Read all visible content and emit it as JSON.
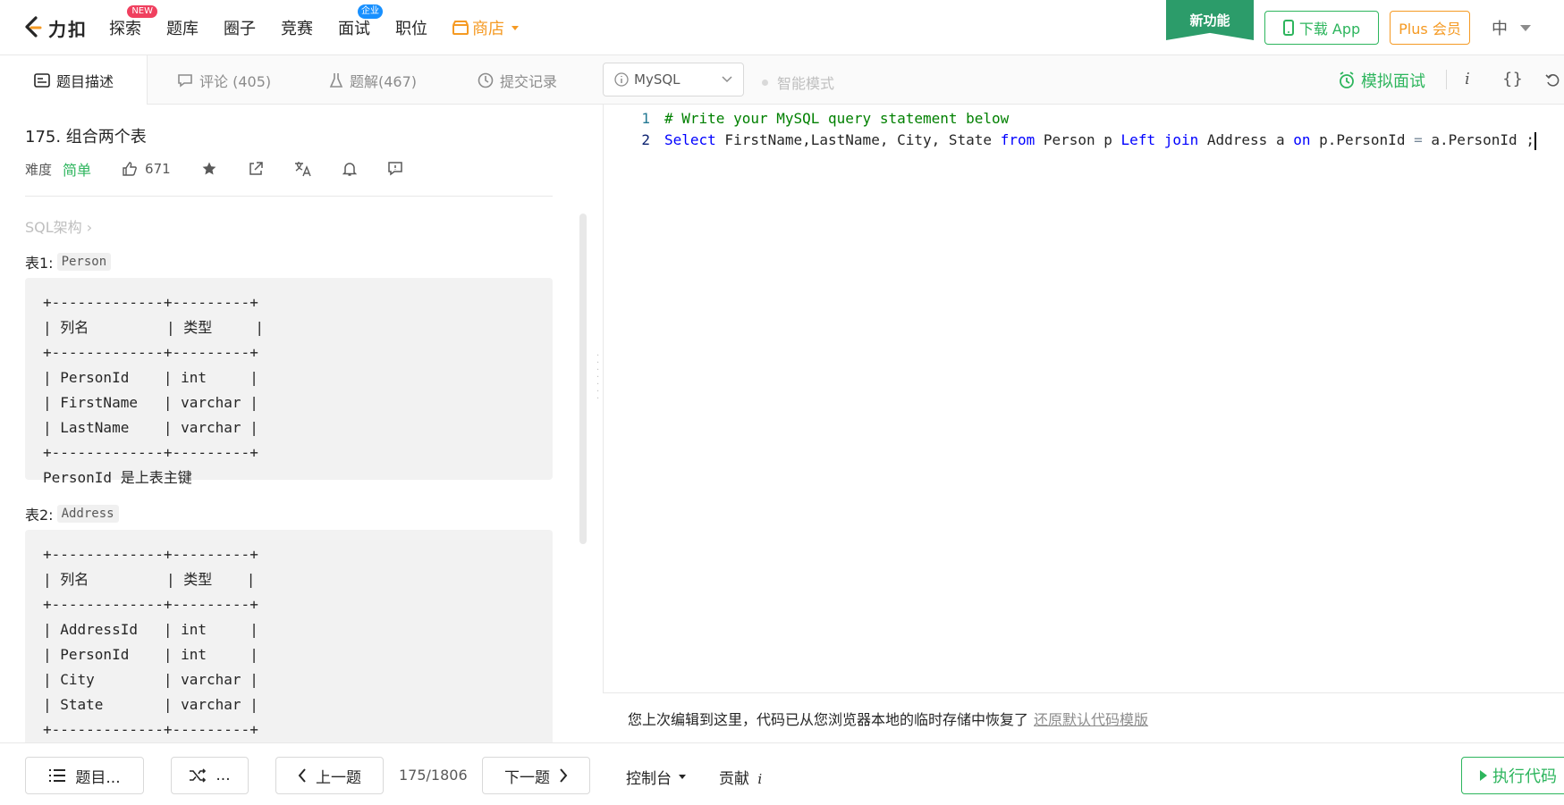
{
  "nav": {
    "logo_text": "力扣",
    "items": [
      {
        "label": "探索",
        "badge": "NEW"
      },
      {
        "label": "题库"
      },
      {
        "label": "圈子"
      },
      {
        "label": "竞赛"
      },
      {
        "label": "面试",
        "badge": "企业"
      },
      {
        "label": "职位"
      }
    ],
    "store_label": "商店",
    "new_feature": "新功能",
    "download_label": "下载 App",
    "plus_label": "Plus 会员",
    "lang_label": "中"
  },
  "tabs": {
    "description": "题目描述",
    "comments": "评论 (405)",
    "solutions": "题解(467)",
    "submissions": "提交记录",
    "language": "MySQL",
    "smart_mode": "智能模式",
    "mock_interview": "模拟面试",
    "info_icon": "i",
    "braces_icon": "{}"
  },
  "problem": {
    "title": "175. 组合两个表",
    "difficulty_label": "难度",
    "difficulty": "简单",
    "likes": "671",
    "schema_link": "SQL架构 ›",
    "table1_label": "表1:",
    "table1_name": "Person",
    "table1_body": "+-------------+---------+\n| 列名         | 类型     |\n+-------------+---------+\n| PersonId    | int     |\n| FirstName   | varchar |\n| LastName    | varchar |\n+-------------+---------+\nPersonId 是上表主键",
    "table2_label": "表2:",
    "table2_name": "Address",
    "table2_body": "+-------------+---------+\n| 列名         | 类型    |\n+-------------+---------+\n| AddressId   | int     |\n| PersonId    | int     |\n| City        | varchar |\n| State       | varchar |\n+-------------+---------+"
  },
  "editor": {
    "line_numbers": [
      "1",
      "2"
    ],
    "line1": "# Write your MySQL query statement below",
    "line2_tokens": [
      {
        "t": "Select",
        "c": "kw"
      },
      {
        "t": " FirstName,LastName, City, State ",
        "c": "id"
      },
      {
        "t": "from",
        "c": "kw"
      },
      {
        "t": " Person p ",
        "c": "id"
      },
      {
        "t": "Left",
        "c": "kw"
      },
      {
        "t": " ",
        "c": "id"
      },
      {
        "t": "join",
        "c": "kw"
      },
      {
        "t": " Address a ",
        "c": "id"
      },
      {
        "t": "on",
        "c": "kw"
      },
      {
        "t": " p.PersonId ",
        "c": "id"
      },
      {
        "t": "=",
        "c": "op"
      },
      {
        "t": " a.PersonId ",
        "c": "id"
      },
      {
        "t": ";",
        "c": "id"
      }
    ],
    "restore_msg": "您上次编辑到这里，代码已从您浏览器本地的临时存储中恢复了",
    "restore_link": "还原默认代码模版"
  },
  "bottom": {
    "list_label": "题目...",
    "random_label": "...",
    "prev_label": "上一题",
    "page": "175/1806",
    "next_label": "下一题",
    "console_label": "控制台",
    "contribute_label": "贡献",
    "run_label": "执行代码"
  },
  "colors": {
    "accent": "#2db55d",
    "store": "#f59a23",
    "badge_new": "#f0405f"
  }
}
